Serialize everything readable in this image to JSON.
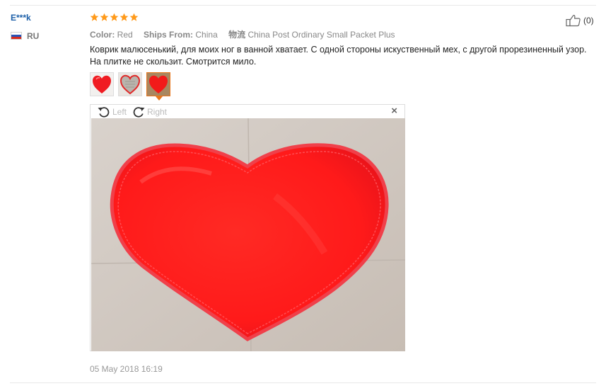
{
  "review": {
    "user": "E***k",
    "country": "RU",
    "rating": 5,
    "attributes": [
      {
        "label": "Color:",
        "value": "Red"
      },
      {
        "label": "Ships From:",
        "value": "China"
      },
      {
        "label": "物流",
        "value": "China Post Ordinary Small Packet Plus"
      }
    ],
    "text": "Коврик малюсенький, для моих ног в ванной хватает. С одной стороны искуственный мех, с другой прорезиненный узор. На плитке не скользит. Смотрится мило.",
    "helpful_count": "(0)",
    "date": "05 May 2018 16:19"
  },
  "viewer": {
    "rotate_left_label": "Left",
    "rotate_right_label": "Right",
    "close_symbol": "×"
  },
  "colors": {
    "star": "#ff9a1a",
    "name": "#1c5fa8",
    "active_thumb": "#e7761d",
    "rug": "#ff1a1a"
  },
  "icons": {
    "helpful": "thumbs-up-icon",
    "rotate_left": "rotate-left-icon",
    "rotate_right": "rotate-right-icon",
    "close": "close-icon"
  }
}
